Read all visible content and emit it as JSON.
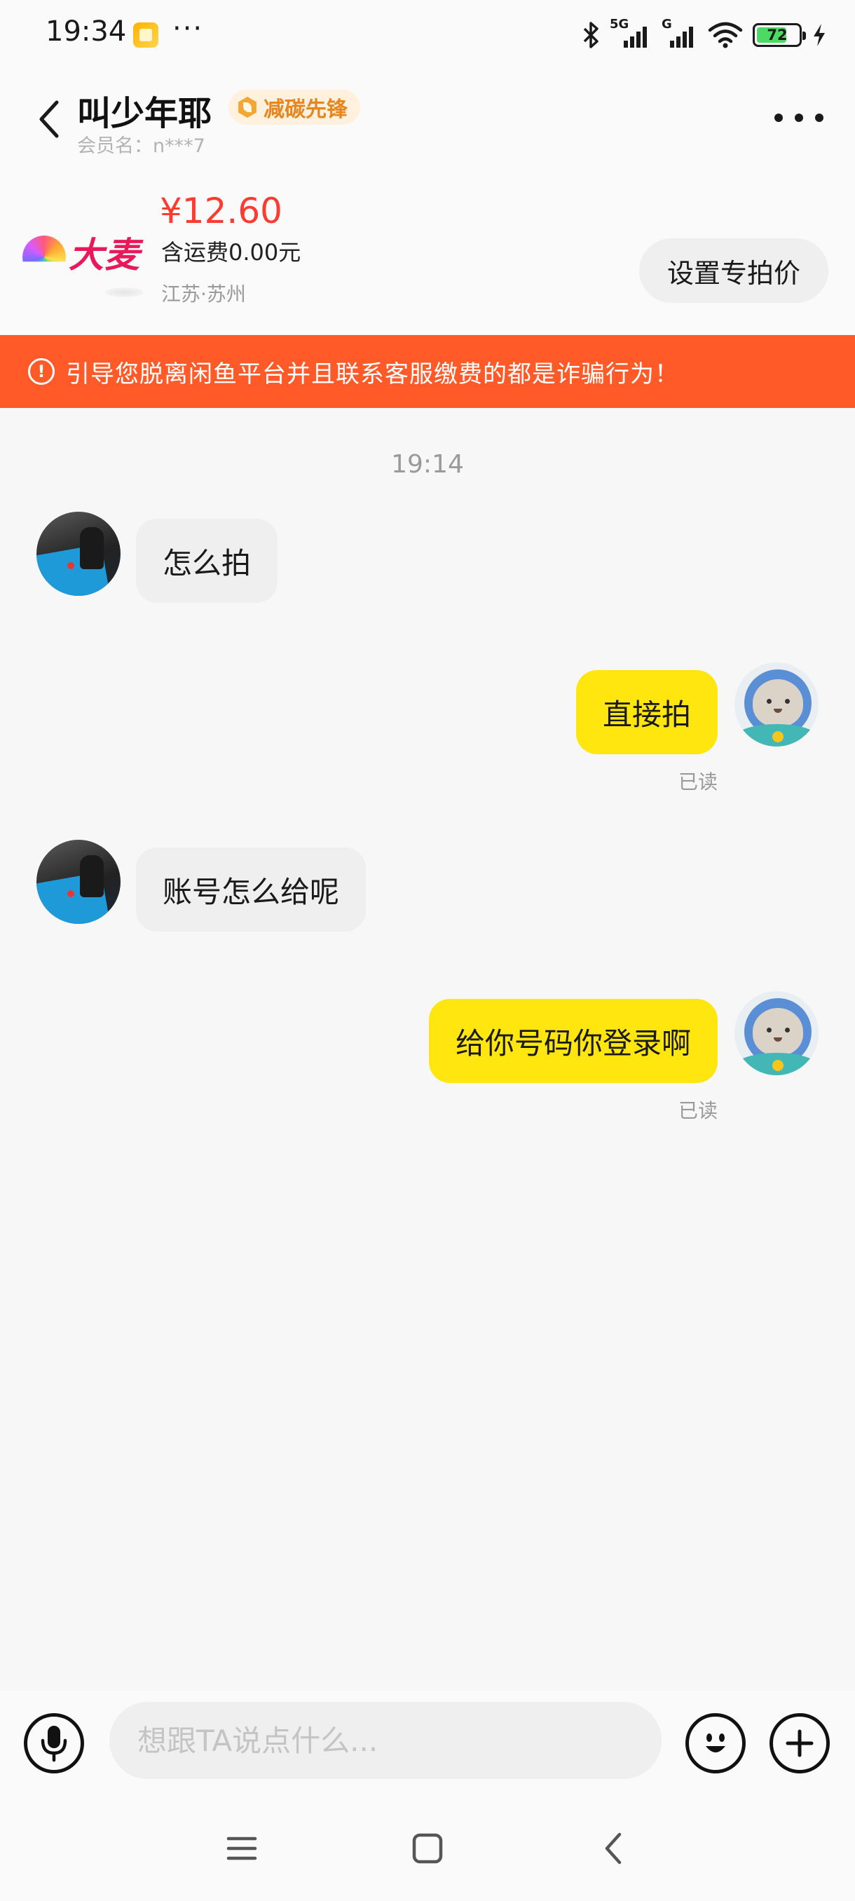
{
  "status_bar": {
    "time": "19:34",
    "dots": "···",
    "network_1": "5G",
    "network_2": "G",
    "battery": "72"
  },
  "header": {
    "title": "叫少年耶",
    "badge": "减碳先锋",
    "member": "会员名：n***7"
  },
  "product": {
    "logo_text": "大麦",
    "price": "¥12.60",
    "shipping": "含运费0.00元",
    "location": "江苏·苏州",
    "set_price_label": "设置专拍价"
  },
  "warning": {
    "icon": "!",
    "text": "引导您脱离闲鱼平台并且联系客服缴费的都是诈骗行为！"
  },
  "chat": {
    "timestamp": "19:14",
    "messages": [
      {
        "from": "other",
        "text": "怎么拍"
      },
      {
        "from": "self",
        "text": "直接拍",
        "status": "已读"
      },
      {
        "from": "other",
        "text": "账号怎么给呢"
      },
      {
        "from": "self",
        "text": "给你号码你登录啊",
        "status": "已读"
      }
    ]
  },
  "input_bar": {
    "placeholder": "想跟TA说点什么..."
  },
  "colors": {
    "accent_yellow": "#ffe60f",
    "warning_orange": "#ff5a28",
    "price_red": "#ff3b30"
  },
  "icons": [
    "back-arrow-icon",
    "more-dots-icon",
    "microphone-icon",
    "emoji-icon",
    "plus-icon",
    "menu-icon",
    "home-icon",
    "back-nav-icon"
  ]
}
